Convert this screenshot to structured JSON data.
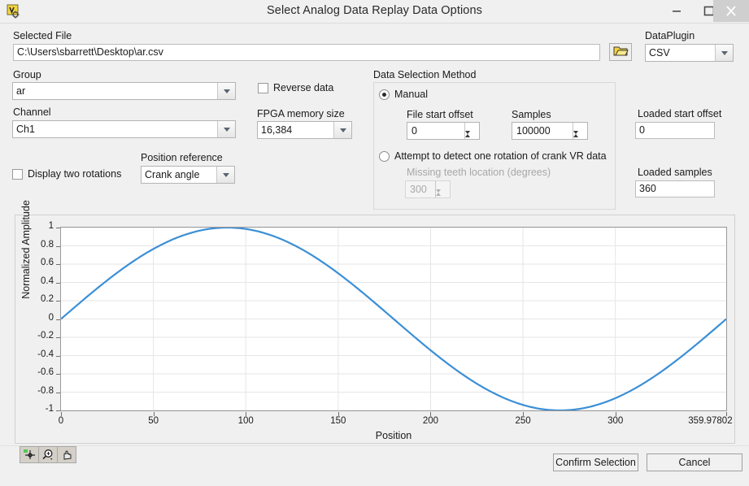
{
  "window": {
    "title": "Select Analog Data Replay Data Options",
    "app_icon": "labview-vi-icon",
    "minimize": "–",
    "maximize": "❐",
    "close": "✕"
  },
  "form": {
    "selected_file_label": "Selected File",
    "selected_file_value": "C:\\Users\\sbarrett\\Desktop\\ar.csv",
    "browse_icon": "folder-open-icon",
    "dataplugin_label": "DataPlugin",
    "dataplugin_value": "CSV",
    "group_label": "Group",
    "group_value": "ar",
    "channel_label": "Channel",
    "channel_value": "Ch1",
    "reverse_data_label": "Reverse data",
    "reverse_data_checked": false,
    "fpga_memory_label": "FPGA memory size",
    "fpga_memory_value": "16,384",
    "display_two_rotations_label": "Display two rotations",
    "display_two_rotations_checked": false,
    "position_reference_label": "Position reference",
    "position_reference_value": "Crank angle",
    "loaded_start_offset_label": "Loaded start offset",
    "loaded_start_offset_value": "0",
    "loaded_samples_label": "Loaded samples",
    "loaded_samples_value": "360"
  },
  "data_selection": {
    "group_title": "Data Selection Method",
    "manual_label": "Manual",
    "manual_selected": true,
    "file_start_offset_label": "File start offset",
    "file_start_offset_value": "0",
    "samples_label": "Samples",
    "samples_value": "100000",
    "auto_detect_label": "Attempt to detect one rotation of crank VR data",
    "auto_detect_selected": false,
    "missing_teeth_label": "Missing teeth location (degrees)",
    "missing_teeth_value": "300",
    "missing_teeth_disabled": true
  },
  "palette": {
    "cursor_tool": "crosshair-cursor-icon",
    "zoom_tool": "magnifier-zoom-icon",
    "pan_tool": "hand-pan-icon"
  },
  "footer": {
    "confirm_label": "Confirm Selection",
    "cancel_label": "Cancel"
  },
  "colors": {
    "plot_line": "#3b8fd6",
    "window_bg": "#f0f0f0",
    "plot_bg": "#ffffff",
    "grid": "#e6e6e6"
  },
  "chart_data": {
    "type": "line",
    "title": "",
    "xlabel": "Position",
    "ylabel": "Normalized Amplitude",
    "xlim": [
      0,
      359.97802
    ],
    "ylim": [
      -1,
      1
    ],
    "grid": true,
    "legend": "none",
    "xticks": [
      0,
      50,
      100,
      150,
      200,
      250,
      300,
      359.97802
    ],
    "xticklabels": [
      "0",
      "50",
      "100",
      "150",
      "200",
      "250",
      "300",
      "359.97802"
    ],
    "yticks": [
      -1,
      -0.8,
      -0.6,
      -0.4,
      -0.2,
      0,
      0.2,
      0.4,
      0.6,
      0.8,
      1
    ],
    "yticklabels": [
      "-1",
      "-0.8",
      "-0.6",
      "-0.4",
      "-0.2",
      "0",
      "0.2",
      "0.4",
      "0.6",
      "0.8",
      "1"
    ],
    "series": [
      {
        "name": "Ch1",
        "color": "#3b8fd6",
        "x": [
          0,
          10,
          20,
          30,
          40,
          50,
          60,
          70,
          80,
          90,
          100,
          110,
          120,
          130,
          140,
          150,
          160,
          170,
          180,
          190,
          200,
          210,
          220,
          230,
          240,
          250,
          260,
          270,
          280,
          290,
          300,
          310,
          320,
          330,
          340,
          350,
          359.97802
        ],
        "y": [
          0,
          0.174,
          0.342,
          0.5,
          0.643,
          0.766,
          0.866,
          0.94,
          0.985,
          1,
          0.985,
          0.94,
          0.866,
          0.766,
          0.643,
          0.5,
          0.342,
          0.174,
          0,
          -0.174,
          -0.342,
          -0.5,
          -0.643,
          -0.766,
          -0.866,
          -0.94,
          -0.985,
          -1,
          -0.985,
          -0.94,
          -0.866,
          -0.766,
          -0.643,
          -0.5,
          -0.342,
          -0.174,
          0
        ]
      }
    ]
  }
}
